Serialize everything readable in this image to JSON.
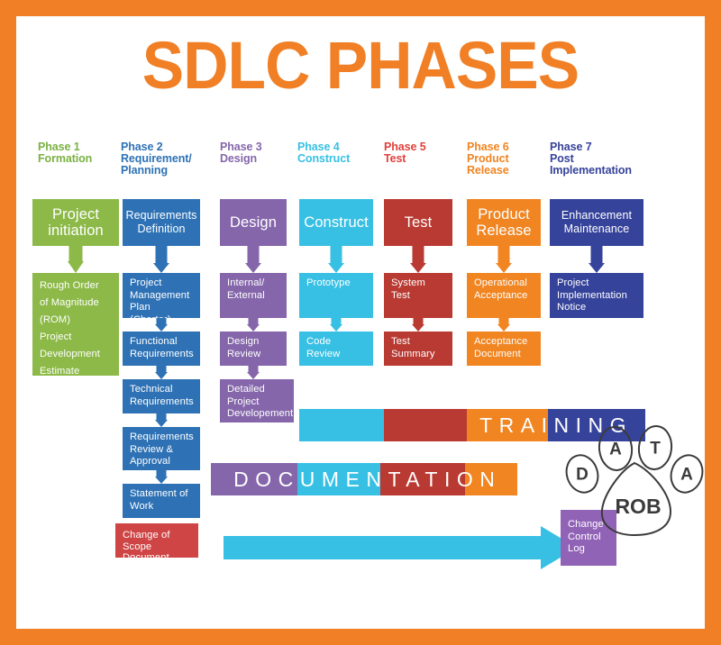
{
  "page": {
    "title": "SDLC PHASES",
    "frame_color": "#f07f25",
    "background": "#ffffff"
  },
  "colors": {
    "green": "#8cb948",
    "blue": "#2e72b5",
    "purple": "#8566ab",
    "cyan": "#38c0e4",
    "red": "#b93a32",
    "orange": "#f08522",
    "navy": "#36439b",
    "scope_red": "#cf4444",
    "change_purple": "#9163b6",
    "paw_stroke": "#3b3b3b"
  },
  "phases": [
    {
      "id": "phase-1",
      "header": "Phase 1\nFormation",
      "header_color": "#7ab143",
      "box_color": "#8cb948",
      "nodes": [
        {
          "label": "Project\ninitiation",
          "kind": "head"
        },
        {
          "label": "Rough Order\nof Magnitude\n(ROM)\nProject\nDevelopment\nEstimate",
          "kind": "body"
        }
      ]
    },
    {
      "id": "phase-2",
      "header": "Phase 2\nRequirement/\nPlanning",
      "header_color": "#2e72b5",
      "box_color": "#2e72b5",
      "nodes": [
        {
          "label": "Requirements\nDefinition",
          "kind": "head"
        },
        {
          "label": "Project\nManagement\nPlan (Charter)",
          "kind": "body"
        },
        {
          "label": "Functional\nRequirements",
          "kind": "body"
        },
        {
          "label": "Technical\nRequirements",
          "kind": "body"
        },
        {
          "label": "Requirements\nReview &\nApproval",
          "kind": "body"
        },
        {
          "label": "Statement of\nWork",
          "kind": "body"
        }
      ]
    },
    {
      "id": "phase-3",
      "header": "Phase 3\nDesign",
      "header_color": "#8566ab",
      "box_color": "#8566ab",
      "nodes": [
        {
          "label": "Design",
          "kind": "head"
        },
        {
          "label": "Internal/\nExternal",
          "kind": "body"
        },
        {
          "label": "Design\nReview",
          "kind": "body"
        },
        {
          "label": "Detailed\nProject\nDevelopement",
          "kind": "body"
        }
      ]
    },
    {
      "id": "phase-4",
      "header": "Phase 4\nConstruct",
      "header_color": "#38c0e4",
      "box_color": "#38c0e4",
      "nodes": [
        {
          "label": "Construct",
          "kind": "head"
        },
        {
          "label": "Prototype",
          "kind": "body"
        },
        {
          "label": "Code\nReview",
          "kind": "body"
        }
      ]
    },
    {
      "id": "phase-5",
      "header": "Phase 5\nTest",
      "header_color": "#e1413c",
      "box_color": "#b93a32",
      "nodes": [
        {
          "label": "Test",
          "kind": "head"
        },
        {
          "label": "System\nTest",
          "kind": "body"
        },
        {
          "label": "Test\nSummary",
          "kind": "body"
        }
      ]
    },
    {
      "id": "phase-6",
      "header": "Phase 6\nProduct\nRelease",
      "header_color": "#f08522",
      "box_color": "#f08522",
      "nodes": [
        {
          "label": "Product\nRelease",
          "kind": "head"
        },
        {
          "label": "Operational\nAcceptance",
          "kind": "body"
        },
        {
          "label": "Acceptance\nDocument",
          "kind": "body"
        }
      ]
    },
    {
      "id": "phase-7",
      "header": "Phase 7\nPost\nImplementation",
      "header_color": "#36439b",
      "box_color": "#36439b",
      "nodes": [
        {
          "label": "Enhancement\nMaintenance",
          "kind": "head"
        },
        {
          "label": "Project\nImplementation\nNotice",
          "kind": "body"
        }
      ]
    }
  ],
  "bands": [
    {
      "id": "training",
      "label": "TRAINING",
      "segments": [
        "#38c0e4",
        "#b93a32",
        "#f08522",
        "#36439b"
      ]
    },
    {
      "id": "documentation",
      "label": "DOCUMENTATION",
      "segments": [
        "#8566ab",
        "#38c0e4",
        "#b93a32",
        "#f08522"
      ]
    }
  ],
  "change_flow": {
    "source_label": "Change of Scope\nDocument",
    "source_color": "#cf4444",
    "arrow_color": "#38c0e4",
    "target_label": "Change\nControl\nLog",
    "target_color": "#9163b6"
  },
  "watermark": {
    "name": "paw-print-logo",
    "toes": [
      "D",
      "A",
      "T",
      "A"
    ],
    "center": "ROB"
  }
}
